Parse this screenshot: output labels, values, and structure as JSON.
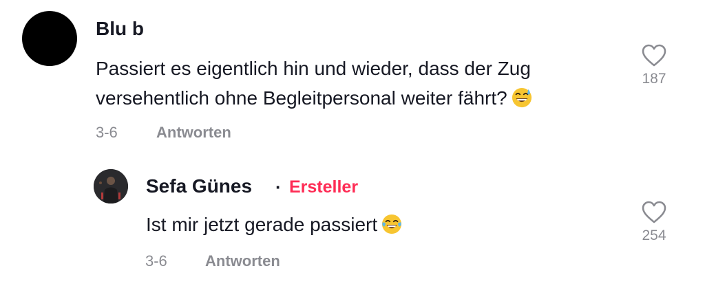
{
  "comment": {
    "username": "Blu b",
    "text": "Passiert es eigentlich hin und wieder, dass der Zug",
    "text_line2": "versehentlich ohne Begleitpersonal weiter fährt?",
    "emoji_icon": "grinning-face-with-sweat-emoji",
    "date": "3-6",
    "reply_label": "Antworten",
    "like_count": "187",
    "avatar_color": "#000000"
  },
  "reply": {
    "username": "Sefa Günes",
    "separator": "·",
    "creator_badge": "Ersteller",
    "text": "Ist mir jetzt gerade passiert",
    "emoji_icon": "face-with-tears-of-joy-emoji",
    "date": "3-6",
    "reply_label": "Antworten",
    "like_count": "254"
  },
  "colors": {
    "text": "#161823",
    "muted": "#8a8b91",
    "creator": "#fe2c55",
    "heart_outline": "#8a8b91"
  }
}
